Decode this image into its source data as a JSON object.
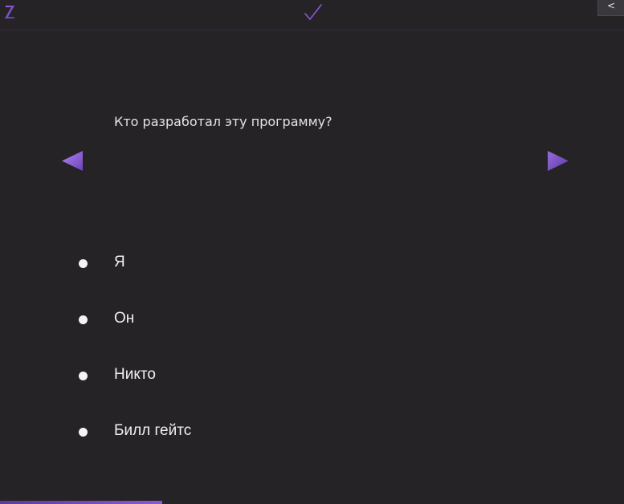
{
  "toolbar": {
    "logo_icon": "z-logo-icon",
    "check_icon": "checkmark-icon",
    "collapse_label": "<"
  },
  "quiz": {
    "question": "Кто разработал эту программу?",
    "prev_icon": "triangle-left-icon",
    "next_icon": "triangle-right-icon",
    "options": [
      {
        "label": "Я"
      },
      {
        "label": "Он"
      },
      {
        "label": "Никто"
      },
      {
        "label": "Билл гейтс"
      }
    ]
  },
  "progress": {
    "fraction": 0.26
  },
  "colors": {
    "background": "#252326",
    "accent": "#8a58d6",
    "accent_dark": "#5b3aa0",
    "text": "#f0f0f0"
  }
}
